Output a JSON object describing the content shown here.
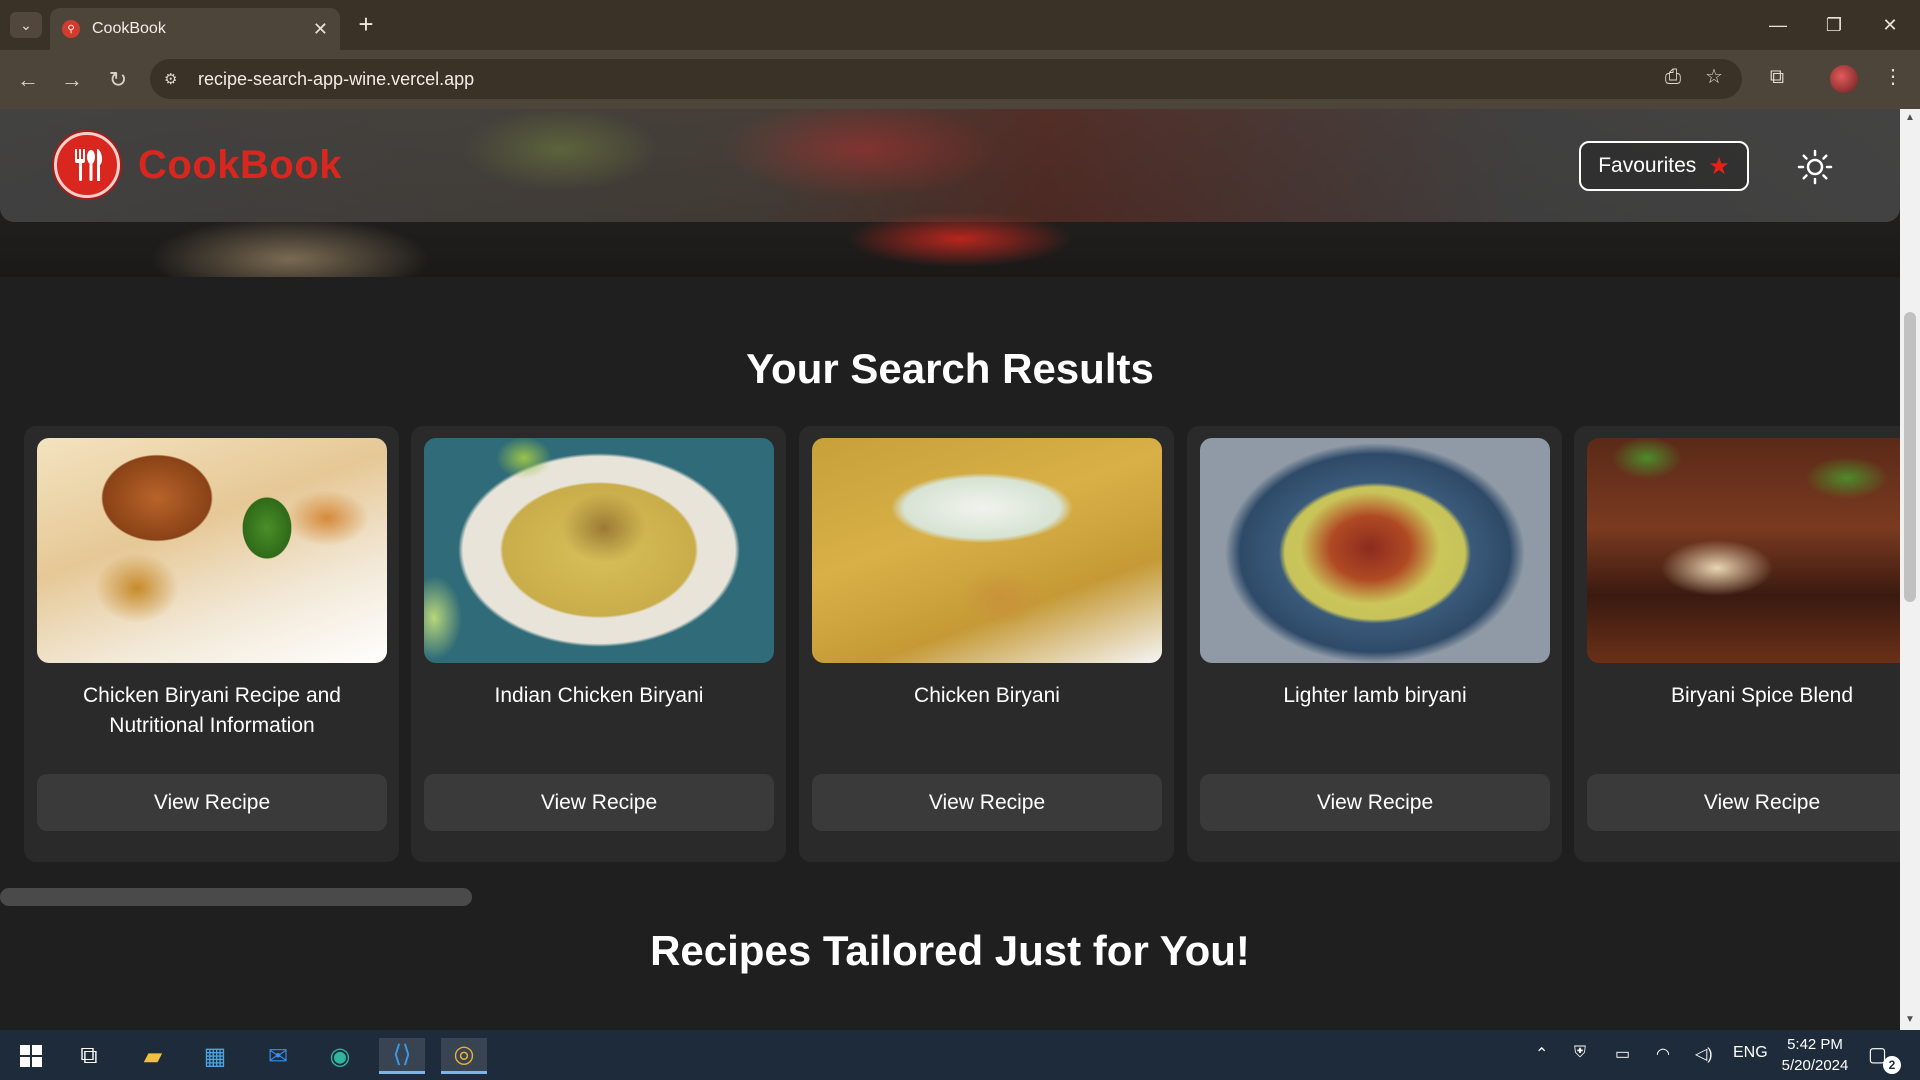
{
  "browser": {
    "tab_title": "CookBook",
    "tab_close": "✕",
    "new_tab": "+",
    "url": "recipe-search-app-wine.vercel.app",
    "window_controls": [
      "—",
      "❐",
      "✕"
    ]
  },
  "header": {
    "brand": "CookBook",
    "favourites_label": "Favourites",
    "favourites_icon": "★"
  },
  "search_results": {
    "title": "Your Search Results",
    "cards": [
      {
        "name": "Chicken Biryani Recipe and Nutritional Information",
        "button": "View Recipe"
      },
      {
        "name": "Indian Chicken Biryani",
        "button": "View Recipe"
      },
      {
        "name": "Chicken Biryani",
        "button": "View Recipe"
      },
      {
        "name": "Lighter lamb biryani",
        "button": "View Recipe"
      },
      {
        "name": "Biryani Spice Blend",
        "button": "View Recipe"
      }
    ]
  },
  "tailored": {
    "title": "Recipes Tailored Just for You!"
  },
  "taskbar": {
    "language": "ENG",
    "time": "5:42 PM",
    "date": "5/20/2024",
    "notification_count": "2"
  },
  "colors": {
    "brand_red": "#d9261f",
    "page_bg": "#1f1f1f",
    "card_bg": "#2a2a2a",
    "button_bg": "#3a3a3a"
  }
}
